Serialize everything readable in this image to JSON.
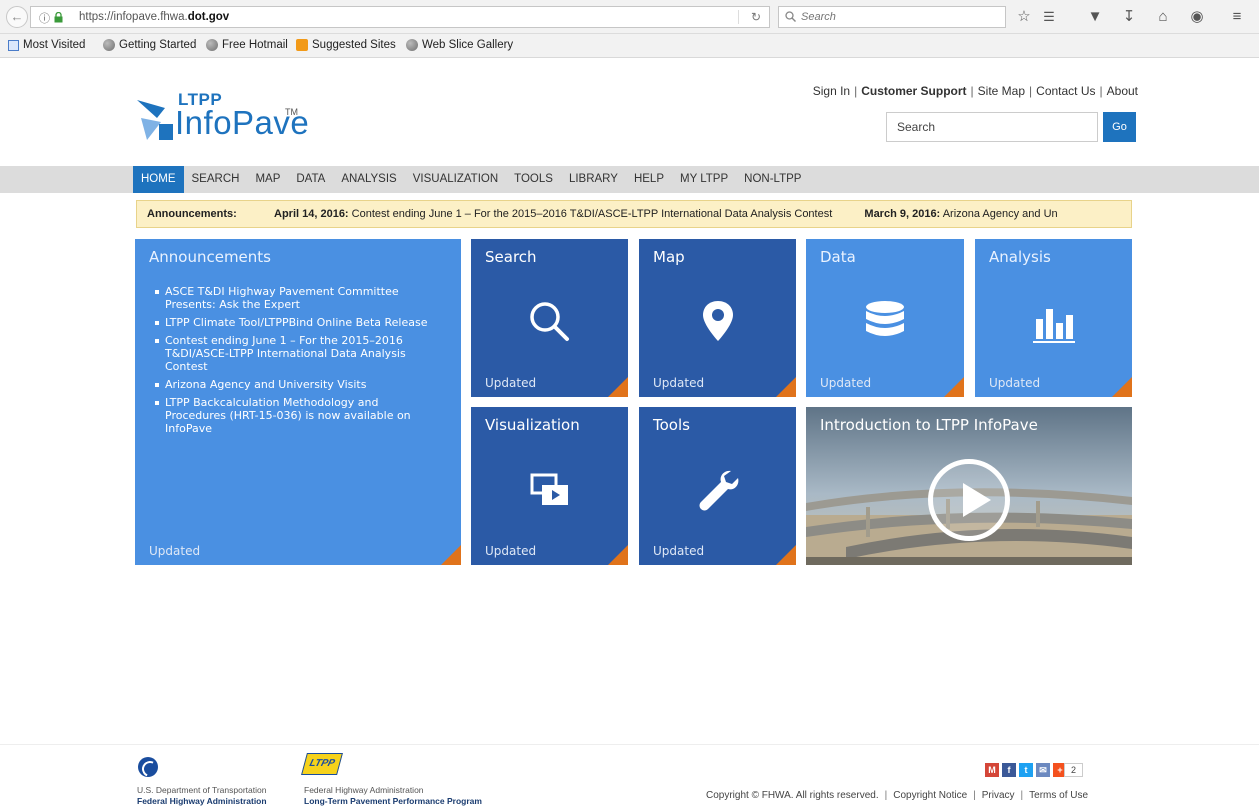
{
  "browser": {
    "url_prefix": "https://infopave.fhwa.",
    "url_domain": "dot.gov",
    "search_placeholder": "Search",
    "toolbar_icons": [
      "star-icon",
      "reading-list-icon",
      "pocket-icon",
      "download-icon",
      "home-icon",
      "chat-icon",
      "menu-icon"
    ],
    "bookmarks": [
      "Most Visited",
      "Getting Started",
      "Free Hotmail",
      "Suggested Sites",
      "Web Slice Gallery"
    ]
  },
  "header": {
    "logo_top": "LTPP",
    "logo_main": "InfoPave",
    "logo_tm": "TM",
    "links": {
      "sign_in": "Sign In",
      "support": "Customer Support",
      "sitemap": "Site Map",
      "contact": "Contact Us",
      "about": "About"
    },
    "separator": "|",
    "search_value": "Search",
    "go_label": "Go"
  },
  "nav": {
    "items": [
      "HOME",
      "SEARCH",
      "MAP",
      "DATA",
      "ANALYSIS",
      "VISUALIZATION",
      "TOOLS",
      "LIBRARY",
      "HELP",
      "MY LTPP",
      "NON-LTPP"
    ],
    "active": "HOME"
  },
  "ticker": {
    "label": "Announcements:",
    "items": [
      {
        "date": "April 14, 2016:",
        "text": "Contest ending June 1 – For the 2015–2016 T&DI/ASCE-LTPP International Data Analysis Contest"
      },
      {
        "date": "March 9, 2016:",
        "text": "Arizona Agency and Un"
      }
    ]
  },
  "tiles": {
    "announcements": {
      "title": "Announcements",
      "items": [
        "ASCE T&DI Highway Pavement Committee Presents: Ask the Expert",
        "LTPP Climate Tool/LTPPBind Online Beta Release",
        "Contest ending June 1 – For the 2015–2016 T&DI/ASCE-LTPP International Data Analysis Contest",
        "Arizona Agency and University Visits",
        "LTPP Backcalculation Methodology and Procedures (HRT-15-036) is now available on InfoPave"
      ],
      "status": "Updated"
    },
    "search": {
      "title": "Search",
      "status": "Updated",
      "icon": "search-icon"
    },
    "map": {
      "title": "Map",
      "status": "Updated",
      "icon": "map-pin-icon"
    },
    "data": {
      "title": "Data",
      "status": "Updated",
      "icon": "database-icon"
    },
    "analysis": {
      "title": "Analysis",
      "status": "Updated",
      "icon": "bar-chart-icon"
    },
    "visualization": {
      "title": "Visualization",
      "status": "Updated",
      "icon": "media-icon"
    },
    "tools": {
      "title": "Tools",
      "status": "Updated",
      "icon": "wrench-icon"
    },
    "video": {
      "title": "Introduction to LTPP InfoPave",
      "icon": "play-icon"
    }
  },
  "footer": {
    "dot_line1": "U.S. Department of Transportation",
    "dot_line2": "Federal Highway Administration",
    "ltpp_badge": "LTPP",
    "fhwa_line1": "Federal Highway Administration",
    "fhwa_line2": "Long-Term Pavement Performance Program",
    "share_count": "2",
    "copyright": "Copyright © FHWA. All rights reserved.",
    "copyright_notice": "Copyright Notice",
    "privacy": "Privacy",
    "terms": "Terms of Use"
  },
  "colors": {
    "brand_blue": "#1e73be",
    "tile_dark": "#2b5aa6",
    "tile_light": "#4a90e2",
    "corner_orange": "#e0731b",
    "ticker_bg": "#fcf0c6"
  }
}
